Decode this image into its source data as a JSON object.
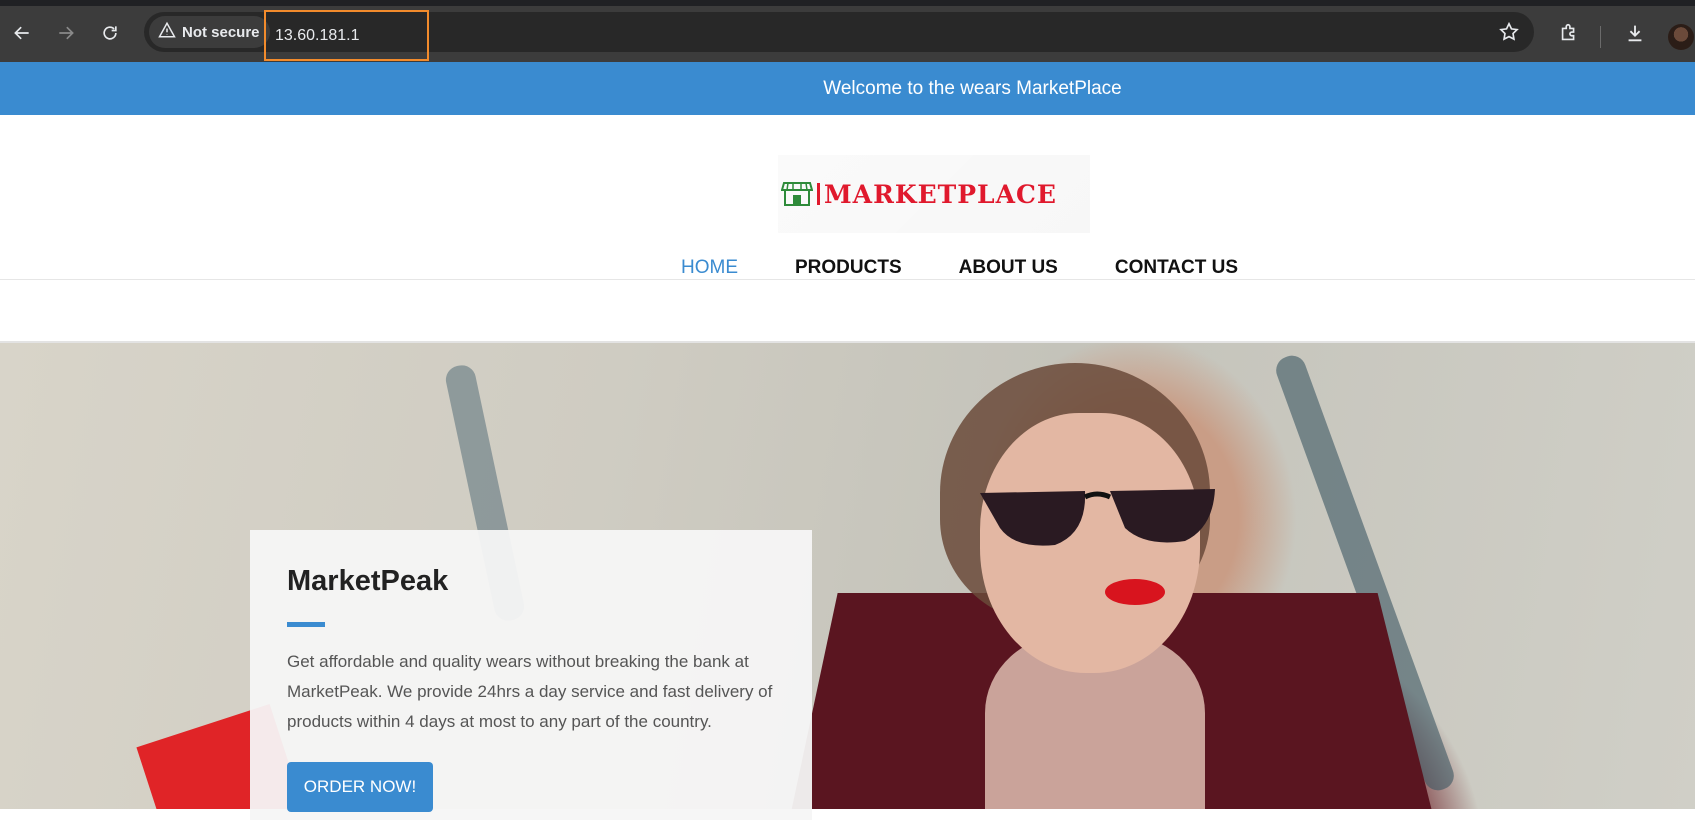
{
  "browser": {
    "security_label": "Not secure",
    "url": "13.60.181.1",
    "icons": [
      "back-icon",
      "forward-icon",
      "reload-icon",
      "warning-icon",
      "star-icon",
      "extensions-icon",
      "download-icon",
      "profile-avatar"
    ]
  },
  "site": {
    "welcome_banner": "Welcome to the wears MarketPlace",
    "logo_text": "MARKETPLACE",
    "nav": {
      "home": "HOME",
      "products": "PRODUCTS",
      "about": "ABOUT US",
      "contact": "CONTACT US"
    },
    "hero": {
      "title": "MarketPeak",
      "description": "Get affordable and quality wears without breaking the bank at MarketPeak. We provide 24hrs a day service and fast delivery of products within 4 days at most to any part of the country.",
      "cta": "ORDER NOW!"
    }
  },
  "colors": {
    "accent": "#3a8bd0",
    "logo_red": "#e0192d",
    "logo_green": "#2e8b3a",
    "url_highlight": "#f28b2c"
  }
}
